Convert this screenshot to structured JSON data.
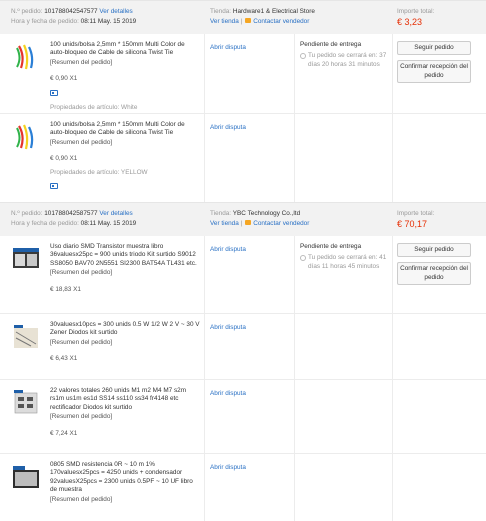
{
  "labels": {
    "order_no": "N.º pedido:",
    "view_details": "Ver detalles",
    "order_time": "Hora y fecha de pedido:",
    "store": "Tienda:",
    "view_store": "Ver tienda",
    "contact_seller": "Contactar vendedor",
    "total": "Importe total:",
    "open_dispute": "Abrir disputa",
    "order_summary": "[Resumen del pedido]",
    "track_order": "Seguir pedido",
    "confirm_receipt": "Confirmar recepción del pedido"
  },
  "orders": [
    {
      "number": "101788042547577",
      "time": "08:11 May. 15 2019",
      "store": "Hardware1 & Electrical Store",
      "total": "€ 3,23",
      "status": "Pendiente de entrega",
      "countdown": "Tu pedido se cerrará en: 37 días 20 horas 31 minutos",
      "items": [
        {
          "title": "100 unids/bolsa 2,5mm * 150mm Multi Color de auto-bloqueo de Cable de silicona Twist Tie",
          "price": "€ 0,90 X1",
          "property": "Propiedades de artículo: White",
          "thumb": "cable-ties"
        },
        {
          "title": "100 unids/bolsa 2,5mm * 150mm Multi Color de auto-bloqueo de Cable de silicona Twist Tie",
          "price": "€ 0,90 X1",
          "property": "Propiedades de artículo: YELLOW",
          "thumb": "cable-ties"
        }
      ]
    },
    {
      "number": "101788042587577",
      "time": "08:11 May. 15 2019",
      "store": "YBC Technology Co.,ltd",
      "total": "€ 70,17",
      "status": "Pendiente de entrega",
      "countdown": "Tu pedido se cerrará en: 41 días 11 horas 45 minutos",
      "items": [
        {
          "title": "Uso diario SMD Transistor muestra libro 36valuesx25pc = 900 unids triodo Kit surtido S9012 SS8050 BAV70 2N5551 SI2300 BAT54A TL431 etc.",
          "price": "€ 18,83 X1",
          "property": "",
          "thumb": "smd-book"
        },
        {
          "title": "30valuesx10pcs = 300 unids 0.5 W 1/2 W 2 V ~ 30 V Zener Diodos kit surtido",
          "price": "€ 6,43 X1",
          "property": "",
          "thumb": "zener-kit"
        },
        {
          "title": "22 valores totales 260 unids M1 m2 M4 M7 s2m rs1m us1m es1d SS14 ss110 ss34 fr4148 etc rectificador Diodos kit surtido",
          "price": "€ 7,24 X1",
          "property": "",
          "thumb": "rectifier-kit"
        },
        {
          "title": "0805 SMD resistencia 0R ~ 10 m 1% 170valuesx25pcs = 4250 unids + condensador 92valuesX25pcs = 2300 unids 0.5PF ~ 10 UF libro de muestra",
          "price": "",
          "property": "",
          "thumb": "resistor-book"
        }
      ]
    }
  ],
  "colors": {
    "link": "#2970c4",
    "price_red": "#e62e04",
    "header_bg": "#f2f2f2"
  }
}
